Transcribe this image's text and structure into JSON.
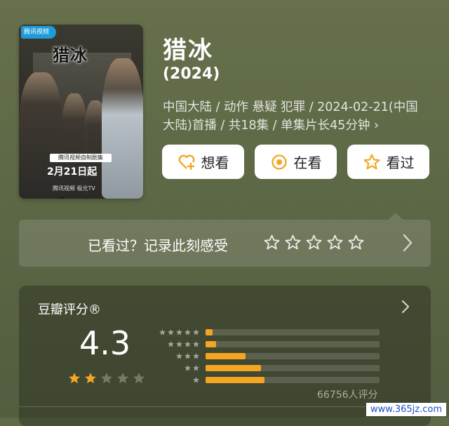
{
  "poster": {
    "logo_text": "腾讯视频",
    "title_art": "猎冰",
    "tag_text": "腾讯视频自制剧集",
    "date_text": "2月21日起",
    "brand_text": "腾讯视频 极光TV"
  },
  "movie": {
    "title": "猎冰",
    "year": "(2024)",
    "meta": "中国大陆 / 动作 悬疑 犯罪 / 2024-02-21(中国大陆)首播 / 共18集 / 单集片长45分钟 ›"
  },
  "actions": {
    "want_label": "想看",
    "watching_label": "在看",
    "watched_label": "看过"
  },
  "rate_prompt": {
    "text": "已看过？记录此刻感受",
    "stars": 5
  },
  "rating": {
    "header": "豆瓣评分®",
    "score": "4.3",
    "score_stars_filled": 2,
    "score_stars_total": 5,
    "distribution": [
      {
        "stars": 5,
        "fraction": 0.04
      },
      {
        "stars": 4,
        "fraction": 0.06
      },
      {
        "stars": 3,
        "fraction": 0.23
      },
      {
        "stars": 2,
        "fraction": 0.32
      },
      {
        "stars": 1,
        "fraction": 0.34
      }
    ],
    "count": "66756人评分"
  },
  "colors": {
    "accent": "#f4a623",
    "want_icon": "#f4a623",
    "watching_icon": "#f4a623"
  },
  "watermark": "www.365jz.com"
}
